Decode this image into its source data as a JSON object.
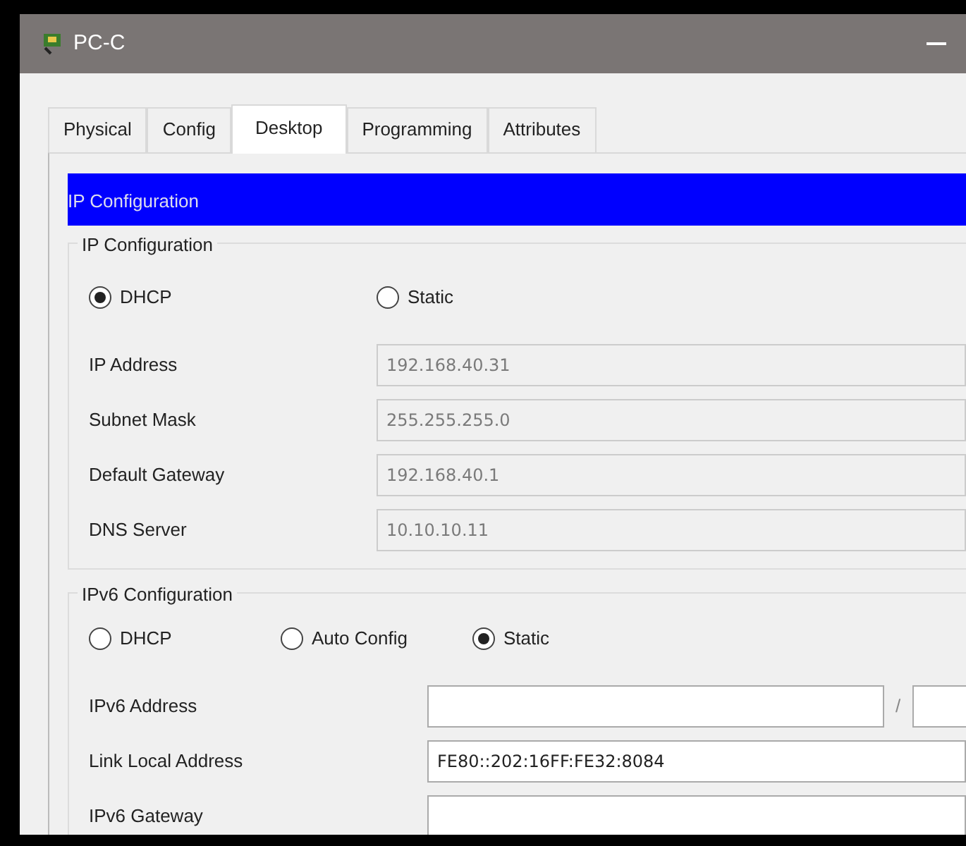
{
  "window": {
    "title": "PC-C"
  },
  "tabs": [
    {
      "label": "Physical",
      "selected": false
    },
    {
      "label": "Config",
      "selected": false
    },
    {
      "label": "Desktop",
      "selected": true
    },
    {
      "label": "Programming",
      "selected": false
    },
    {
      "label": "Attributes",
      "selected": false
    }
  ],
  "header": "IP Configuration",
  "ipv4": {
    "legend": "IP Configuration",
    "modes": [
      {
        "label": "DHCP",
        "selected": true
      },
      {
        "label": "Static",
        "selected": false
      }
    ],
    "fields": [
      {
        "label": "IP Address",
        "value": "192.168.40.31",
        "disabled": true
      },
      {
        "label": "Subnet Mask",
        "value": "255.255.255.0",
        "disabled": true
      },
      {
        "label": "Default Gateway",
        "value": "192.168.40.1",
        "disabled": true
      },
      {
        "label": "DNS Server",
        "value": "10.10.10.11",
        "disabled": true
      }
    ]
  },
  "ipv6": {
    "legend": "IPv6 Configuration",
    "modes": [
      {
        "label": "DHCP",
        "selected": false
      },
      {
        "label": "Auto Config",
        "selected": false
      },
      {
        "label": "Static",
        "selected": true
      }
    ],
    "fields": [
      {
        "label": "IPv6 Address",
        "kind": "prefix",
        "separator": "/",
        "disabled": false
      },
      {
        "label": "Link Local Address",
        "kind": "plain",
        "value": "FE80::202:16FF:FE32:8084",
        "disabled": false
      },
      {
        "label": "IPv6 Gateway",
        "kind": "plain",
        "disabled": false
      }
    ]
  }
}
